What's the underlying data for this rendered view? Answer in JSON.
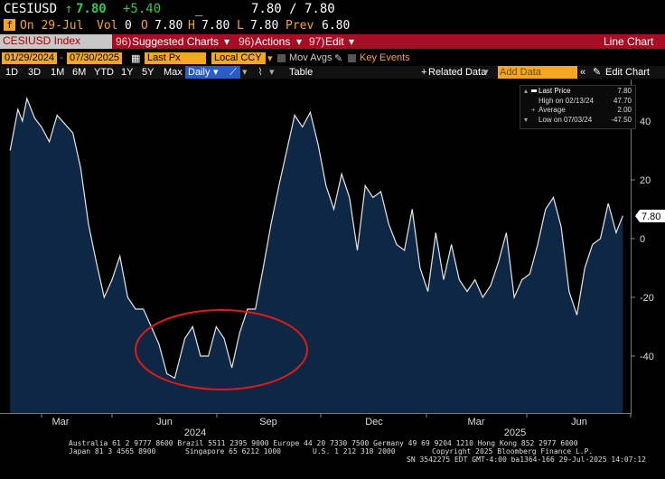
{
  "header": {
    "ticker": "CESIUSD",
    "arrow": "↑",
    "last": "7.80",
    "change": "+5.40",
    "dash": "_",
    "bid_ask": "7.80 / 7.80",
    "row2_icon": "f",
    "date": "On 29-Jul",
    "vol_label": "Vol",
    "vol_value": "0",
    "open_label": "O",
    "open_value": "7.80",
    "high_label": "H",
    "high_value": "7.80",
    "low_label": "L",
    "low_value": "7.80",
    "prev_label": "Prev",
    "prev_value": "6.80"
  },
  "menu": {
    "security": "CESIUSD Index",
    "suggested_num": "96)",
    "suggested": "Suggested Charts",
    "actions_num": "96)",
    "actions": "Actions",
    "edit_num": "97)",
    "edit": "Edit",
    "chart_type": "Line Chart"
  },
  "toolbar": {
    "start_date": "01/29/2024",
    "end_date": "07/30/2025",
    "field": "Last Px",
    "currency": "Local CCY",
    "mov_avgs": "Mov Avgs",
    "key_events": "Key Events"
  },
  "periods": {
    "items": [
      "1D",
      "3D",
      "1M",
      "6M",
      "YTD",
      "1Y",
      "5Y",
      "Max"
    ],
    "frequency": "Daily",
    "table": "Table",
    "related": "Related Data",
    "add_data_placeholder": "Add Data",
    "edit_chart": "Edit Chart"
  },
  "legend": {
    "last_label": "Last Price",
    "last_value": "7.80",
    "high_label": "High on 02/13/24",
    "high_value": "47.70",
    "avg_label": "Average",
    "avg_value": "2.00",
    "low_label": "Low on 07/03/24",
    "low_value": "-47.50"
  },
  "footer": {
    "line1": "Australia 61 2 9777 8600 Brazil 5511 2395 9000 Europe 44 20 7330 7500 Germany 49 69 9204 1210 Hong Kong 852 2977 6000",
    "line2a": "Japan 81 3 4565 8900",
    "line2b": "Singapore 65 6212 1000",
    "line2c": "U.S. 1 212 318 2000",
    "line2d": "Copyright 2025 Bloomberg Finance L.P.",
    "line3": "SN 3542275 EDT  GMT-4:00 ba1364-166 29-Jul-2025 14:07:12"
  },
  "colors": {
    "line": "#e6e6e6",
    "area": "#0d2744",
    "highlight_circle": "#e01a1a",
    "menu_bar": "#a50f23",
    "accent": "#f5a623"
  },
  "chart_data": {
    "type": "area",
    "title": "",
    "xlabel": "",
    "ylabel": "",
    "ylim": [
      -52,
      56
    ],
    "yticks": [
      -40,
      -20,
      0,
      20,
      40
    ],
    "x_tick_labels": [
      "Mar",
      "Jun",
      "Sep",
      "Dec",
      "Mar",
      "Jun"
    ],
    "x_year_labels": [
      "2024",
      "2025"
    ],
    "last_value_label": "7.80",
    "annotation": "highlight circle around mid-2024 trough",
    "series": [
      {
        "x": [
          "2024-01-29",
          "2024-02-05",
          "2024-02-09",
          "2024-02-13",
          "2024-02-20",
          "2024-02-26",
          "2024-03-04",
          "2024-03-11",
          "2024-03-18",
          "2024-03-25",
          "2024-04-01",
          "2024-04-08",
          "2024-04-15",
          "2024-04-22",
          "2024-04-29",
          "2024-05-06",
          "2024-05-13",
          "2024-05-20",
          "2024-05-27",
          "2024-06-03",
          "2024-06-10",
          "2024-06-17",
          "2024-06-24",
          "2024-07-03",
          "2024-07-10",
          "2024-07-17",
          "2024-07-24",
          "2024-07-31",
          "2024-08-07",
          "2024-08-14",
          "2024-08-21",
          "2024-08-28",
          "2024-09-04",
          "2024-09-11",
          "2024-09-18",
          "2024-09-25",
          "2024-10-02",
          "2024-10-09",
          "2024-10-16",
          "2024-10-23",
          "2024-10-30",
          "2024-11-06",
          "2024-11-13",
          "2024-11-20",
          "2024-11-27",
          "2024-12-04",
          "2024-12-11",
          "2024-12-18",
          "2024-12-25",
          "2025-01-01",
          "2025-01-08",
          "2025-01-15",
          "2025-01-22",
          "2025-01-29",
          "2025-02-05",
          "2025-02-12",
          "2025-02-19",
          "2025-02-26",
          "2025-03-05",
          "2025-03-12",
          "2025-03-19",
          "2025-03-26",
          "2025-04-02",
          "2025-04-09",
          "2025-04-16",
          "2025-04-23",
          "2025-04-30",
          "2025-05-07",
          "2025-05-14",
          "2025-05-21",
          "2025-05-28",
          "2025-06-04",
          "2025-06-11",
          "2025-06-18",
          "2025-06-25",
          "2025-07-02",
          "2025-07-09",
          "2025-07-16",
          "2025-07-23",
          "2025-07-29"
        ],
        "values": [
          30,
          44,
          40,
          47.7,
          41,
          38,
          33,
          42,
          39,
          36,
          24,
          5,
          -8,
          -20,
          -14,
          -6,
          -20,
          -24,
          -24,
          -30,
          -36,
          -46,
          -47.5,
          -34,
          -30,
          -40,
          -40,
          -30,
          -34,
          -44,
          -32,
          -24,
          -24,
          -10,
          5,
          18,
          30,
          42,
          38,
          43,
          32,
          18,
          10,
          22,
          14,
          -4,
          18,
          14,
          16,
          5,
          -2,
          -4,
          10,
          -10,
          -18,
          2,
          -14,
          -2,
          -14,
          -18,
          -14,
          -20,
          -16,
          -8,
          2,
          -20,
          -14,
          -12,
          -2,
          10,
          14,
          4,
          -18,
          -26,
          -10,
          -2,
          0,
          12,
          2,
          7.8
        ]
      }
    ]
  }
}
